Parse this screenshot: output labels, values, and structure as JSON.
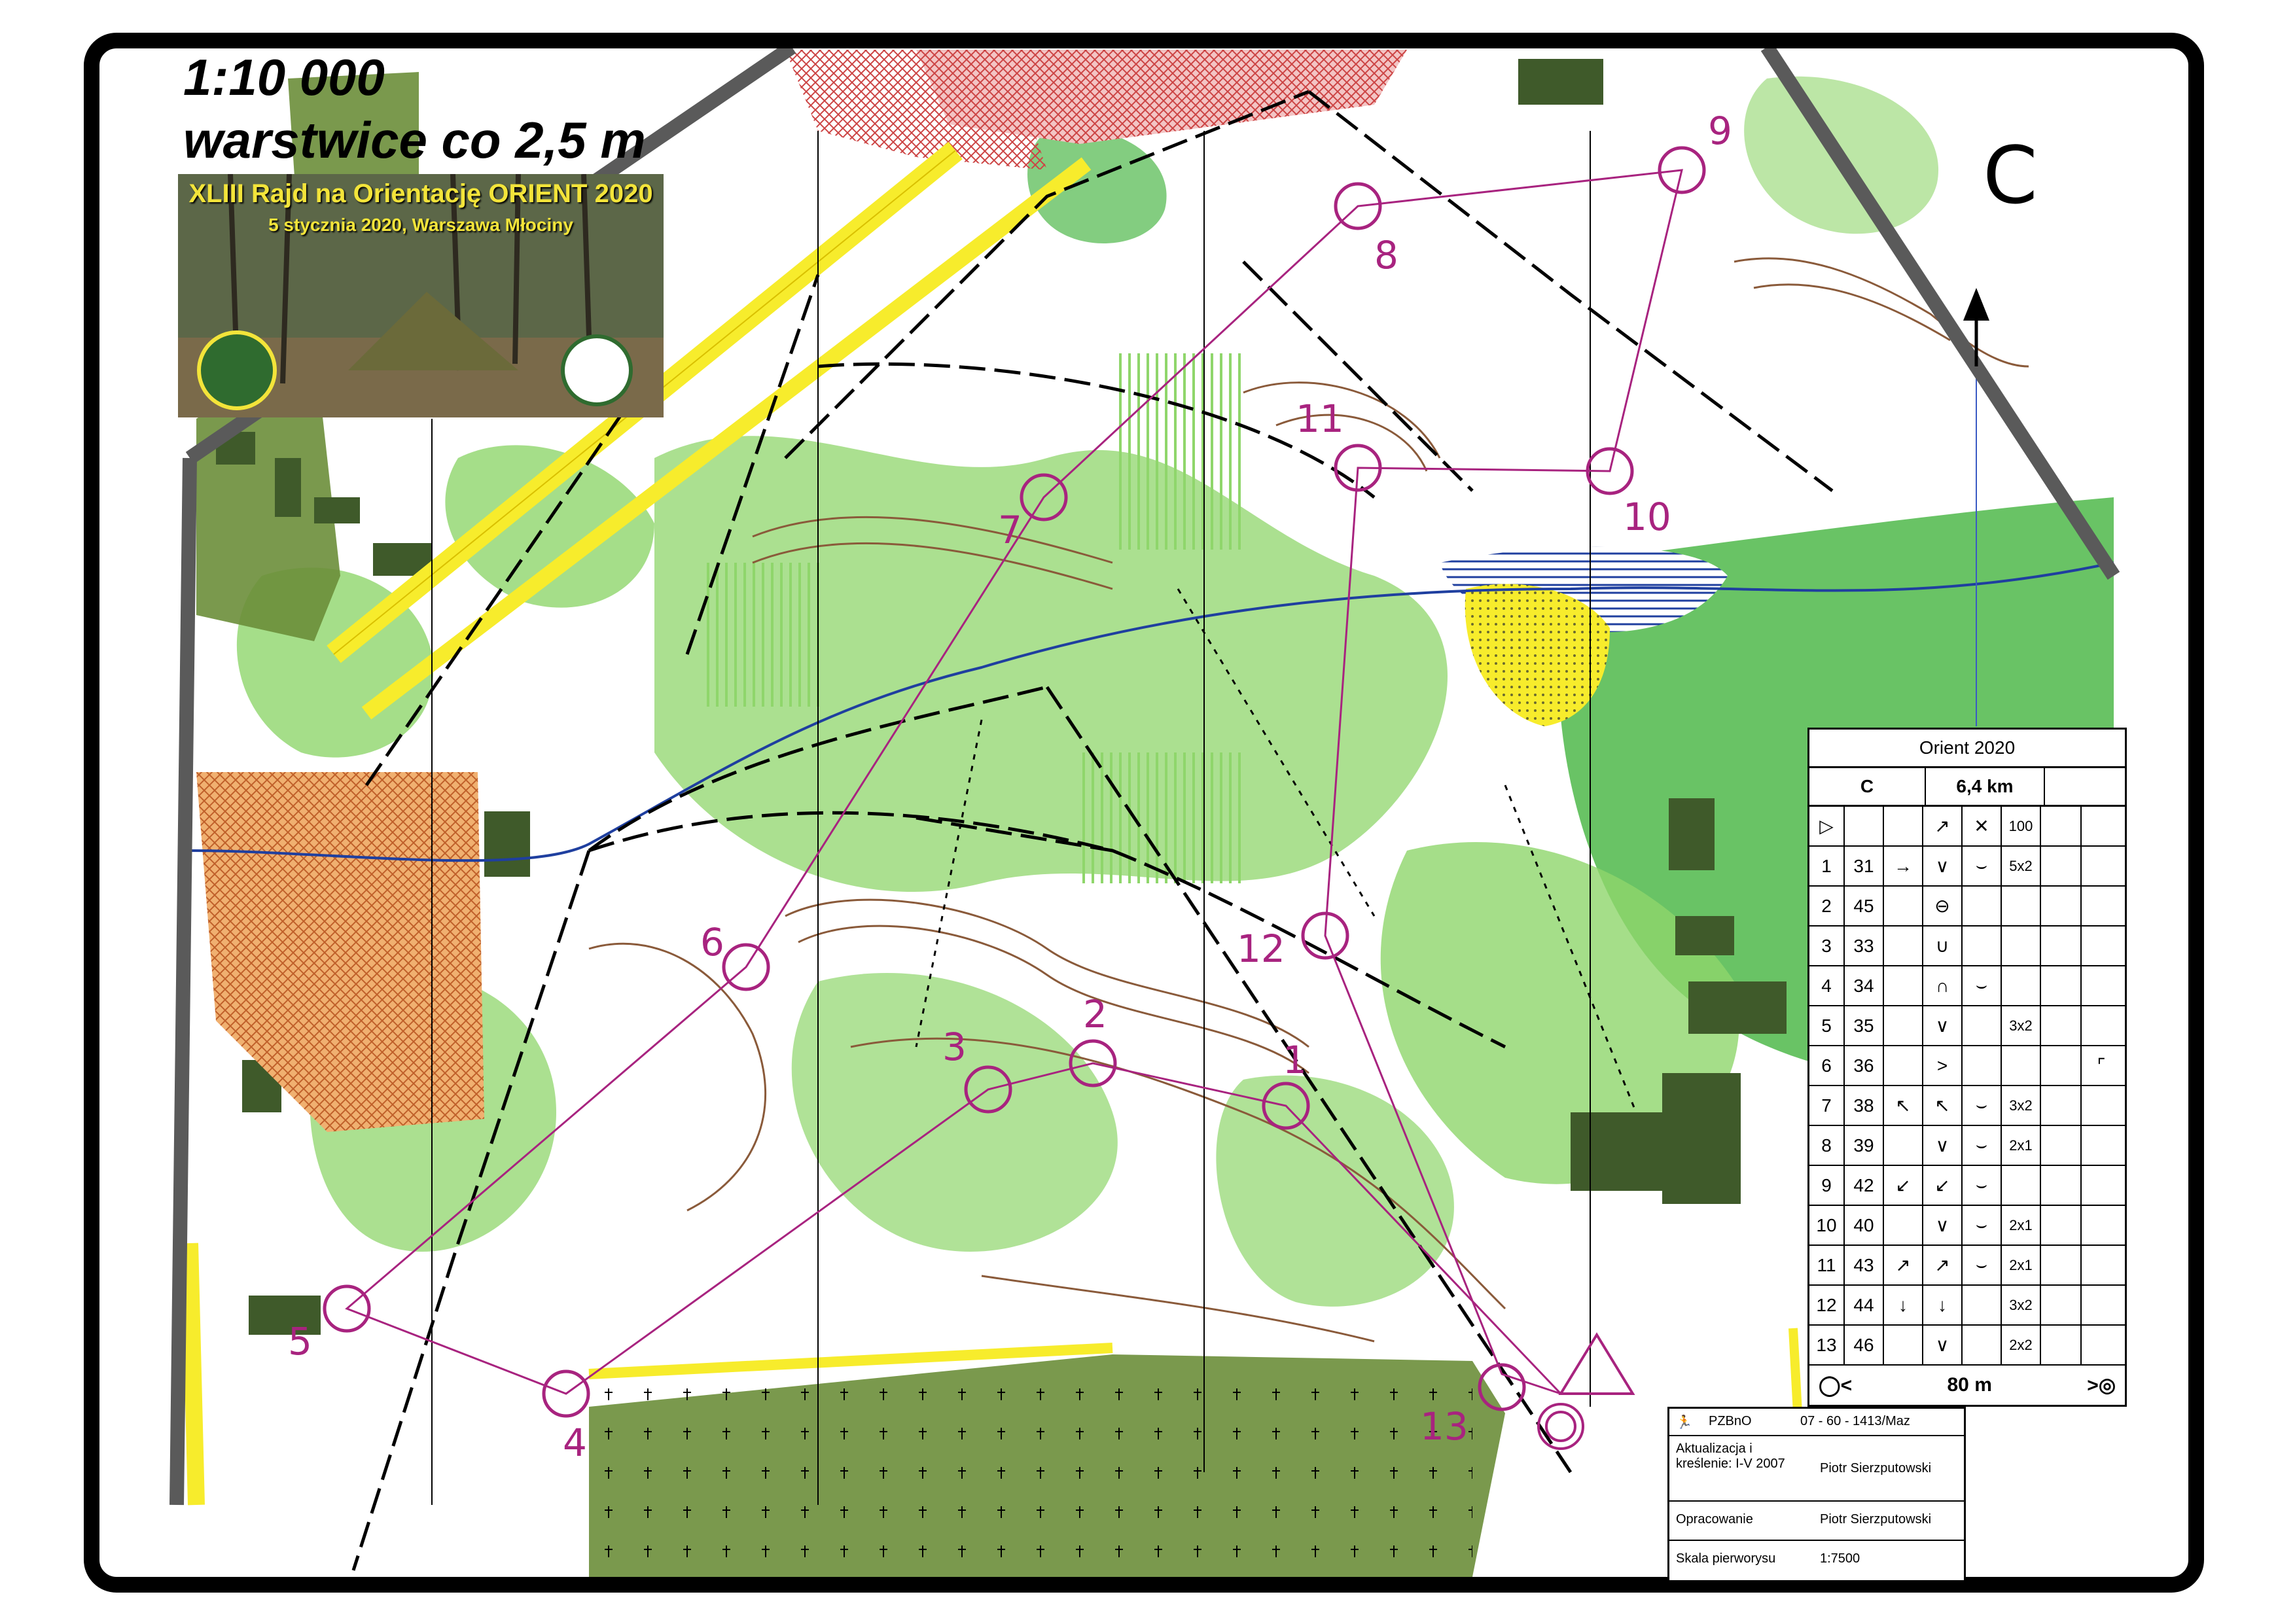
{
  "map": {
    "scale": "1:10 000",
    "contours": "warstwice co 2,5 m",
    "course_letter": "C"
  },
  "banner": {
    "title": "XLIII Rajd na Orientację ORIENT 2020",
    "subtitle": "5 stycznia 2020, Warszawa Młociny"
  },
  "controls": [
    "1",
    "2",
    "3",
    "4",
    "5",
    "6",
    "7",
    "8",
    "9",
    "10",
    "11",
    "12",
    "13"
  ],
  "description": {
    "event": "Orient 2020",
    "course": "C",
    "length": "6,4 km",
    "start_dims": "100",
    "rows": [
      {
        "n": "1",
        "code": "31",
        "dim": "5x2"
      },
      {
        "n": "2",
        "code": "45",
        "dim": ""
      },
      {
        "n": "3",
        "code": "33",
        "dim": ""
      },
      {
        "n": "4",
        "code": "34",
        "dim": ""
      },
      {
        "n": "5",
        "code": "35",
        "dim": "3x2"
      },
      {
        "n": "6",
        "code": "36",
        "dim": ""
      },
      {
        "n": "7",
        "code": "38",
        "dim": "3x2"
      },
      {
        "n": "8",
        "code": "39",
        "dim": "2x1"
      },
      {
        "n": "9",
        "code": "42",
        "dim": ""
      },
      {
        "n": "10",
        "code": "40",
        "dim": "2x1"
      },
      {
        "n": "11",
        "code": "43",
        "dim": "2x1"
      },
      {
        "n": "12",
        "code": "44",
        "dim": "3x2"
      },
      {
        "n": "13",
        "code": "46",
        "dim": "2x2"
      }
    ],
    "finish_distance": "80 m"
  },
  "credits": {
    "org": "PZBnO",
    "license": "07 - 60 - 1413/Maz",
    "update_label": "Aktualizacja i kreślenie: I-V 2007",
    "update_author": "Piotr Sierzputowski",
    "prep_label": "Opracowanie",
    "prep_author": "Piotr Sierzputowski",
    "scale_label": "Skala pierworysu",
    "scale_value": "1:7500"
  },
  "colors": {
    "course": "#a8237f",
    "green_light": "#8fd66b",
    "green_mid": "#4fb84a",
    "green_dark": "#3a8f3a",
    "yellow": "#f7ec2c",
    "olive": "#6b8e3a",
    "building": "#4a6a2f",
    "water": "#1f3f9f",
    "orange": "#e79a4b"
  }
}
